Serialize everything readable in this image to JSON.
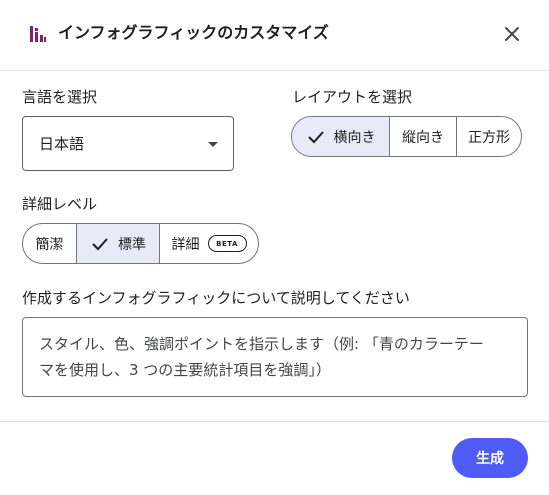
{
  "dialog": {
    "title": "インフォグラフィックのカスタマイズ",
    "accent_color": "#8a1d6e",
    "language": {
      "label": "言語を選択",
      "selected": "日本語"
    },
    "layout": {
      "label": "レイアウトを選択",
      "options": [
        {
          "label": "横向き",
          "selected": true
        },
        {
          "label": "縦向き",
          "selected": false
        },
        {
          "label": "正方形",
          "selected": false
        }
      ]
    },
    "detail": {
      "label": "詳細レベル",
      "options": [
        {
          "label": "簡潔",
          "selected": false
        },
        {
          "label": "標準",
          "selected": true
        },
        {
          "label": "詳細",
          "selected": false,
          "badge": "BETA"
        }
      ]
    },
    "description": {
      "label": "作成するインフォグラフィックについて説明してください",
      "placeholder_line1": "スタイル、色、強調ポイントを指示します（例: 「青のカラーテー",
      "placeholder_line2": "マを使用し、3 つの主要統計項目を強調」）"
    },
    "generate_button": "生成",
    "button_color": "#4e5cf5"
  }
}
